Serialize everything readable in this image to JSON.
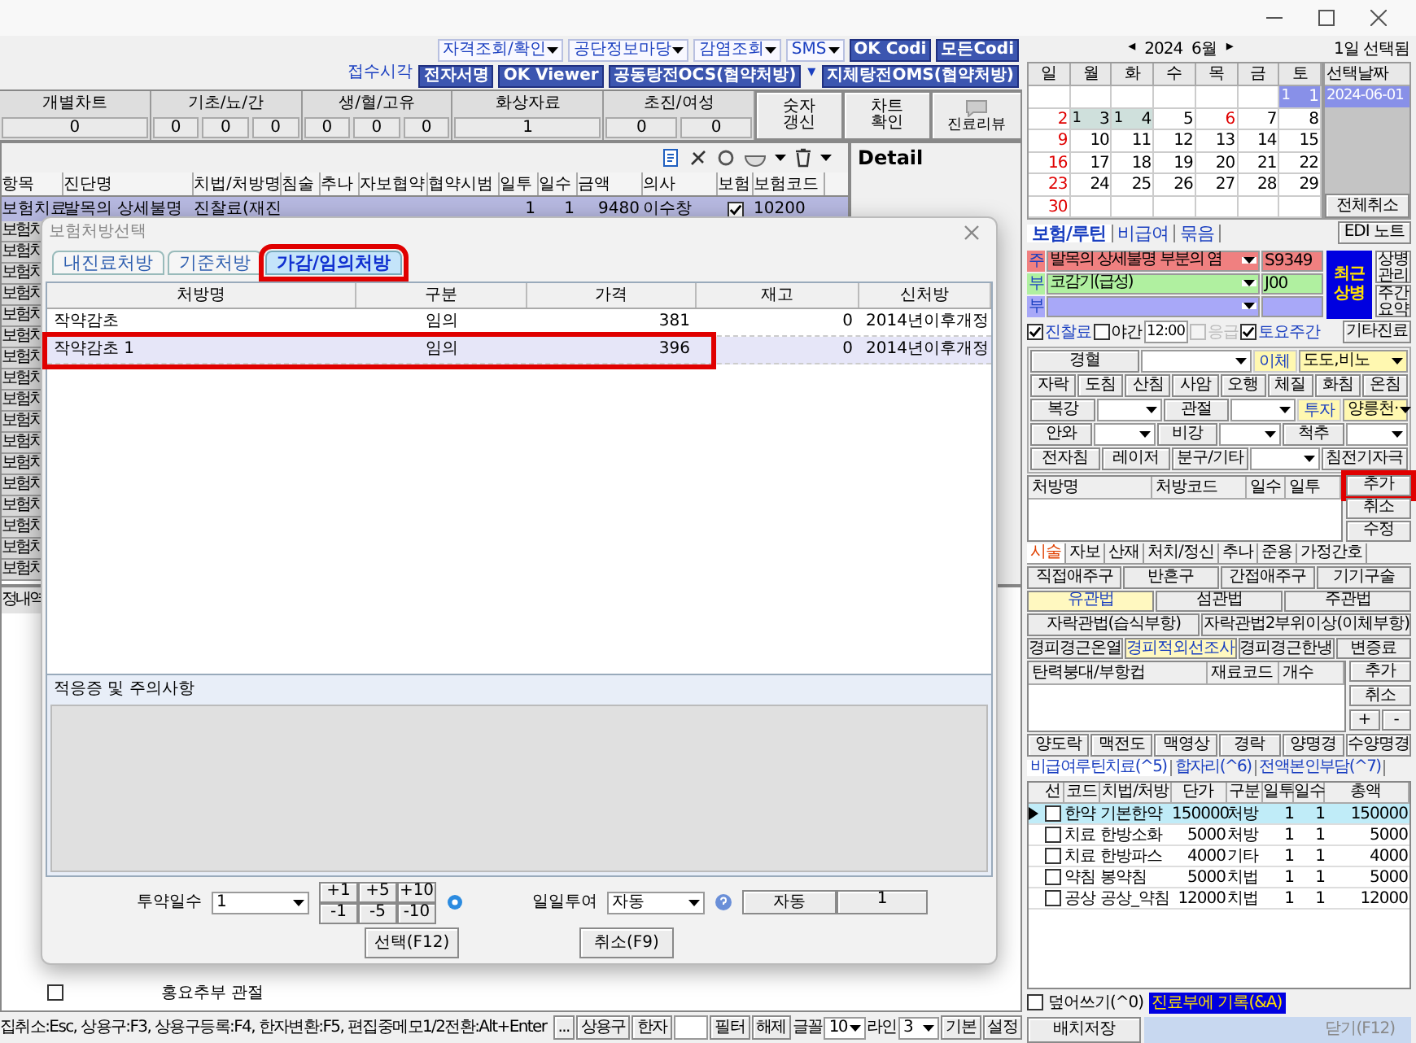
{
  "toolbar": {
    "row1": [
      {
        "label": "자격조회/확인",
        "kind": "dropdown"
      },
      {
        "label": "공단정보마당",
        "kind": "dropdown"
      },
      {
        "label": "감염조회",
        "kind": "dropdown"
      },
      {
        "label": "SMS",
        "kind": "dropdown"
      },
      {
        "label": "OK Codi",
        "kind": "badge"
      },
      {
        "label": "모든Codi",
        "kind": "badge"
      }
    ],
    "row2": [
      {
        "label": "접수시각",
        "kind": "link"
      },
      {
        "label": "전자서명",
        "kind": "badge"
      },
      {
        "label": "OK Viewer",
        "kind": "badge"
      },
      {
        "label": "공동탕전OCS(협약처방)",
        "kind": "badge"
      },
      {
        "label": "▾",
        "kind": "link"
      },
      {
        "label": "지체탕전OMS(협약처방)",
        "kind": "badge"
      }
    ]
  },
  "stats": [
    {
      "label": "개별차트",
      "values": [
        "0"
      ]
    },
    {
      "label": "기초/뇨/간",
      "values": [
        "0",
        "0",
        "0"
      ]
    },
    {
      "label": "생/혈/고유",
      "values": [
        "0",
        "0",
        "0"
      ]
    },
    {
      "label": "화상자료",
      "values": [
        "1"
      ]
    },
    {
      "label": "초진/여성",
      "values": [
        "0",
        "0"
      ]
    }
  ],
  "stat_buttons": [
    "숫자\n갱신",
    "차트\n확인"
  ],
  "review_button": "진료리뷰",
  "main_table": {
    "columns": [
      "항목",
      "진단명",
      "치법/처방명",
      "침술",
      "추나",
      "자보협약",
      "협약시범",
      "일투",
      "일수",
      "금액",
      "의사",
      "보험",
      "보험코드"
    ],
    "rows": [
      {
        "category": "보험치료",
        "diagnosis": "발목의 상세불명",
        "treatment": "진찰료(재진",
        "dose": "1",
        "days": "1",
        "amount": "9480",
        "doctor": "이수창",
        "insured": true,
        "code": "10200"
      }
    ],
    "side_labels": [
      "보험치",
      "보험치",
      "보험치",
      "보험치",
      "보험치",
      "보험치",
      "보험치",
      "보험치",
      "보험치",
      "보험치",
      "보험치",
      "보험치",
      "보험치",
      "보험치",
      "보험치",
      "보험치",
      "보험치"
    ]
  },
  "detail": {
    "title": "Detail"
  },
  "history": {
    "title": "정내역",
    "rows": [
      {
        "label": "홍요추부 관절",
        "checked": false
      }
    ]
  },
  "dialog": {
    "title": "보험처방선택",
    "tabs": [
      {
        "label": "내진료처방",
        "selected": false,
        "annotated": false
      },
      {
        "label": "기준처방",
        "selected": false,
        "annotated": false
      },
      {
        "label": "가감/임의처방",
        "selected": true,
        "annotated": true
      }
    ],
    "columns": [
      "처방명",
      "구분",
      "가격",
      "재고",
      "신처방"
    ],
    "rows": [
      {
        "cells": [
          "작약감초",
          "임의",
          "381",
          "0",
          "2014년이후개정"
        ],
        "selected": false,
        "annotated": false
      },
      {
        "cells": [
          "작약감초 1",
          "임의",
          "396",
          "0",
          "2014년이후개정"
        ],
        "selected": true,
        "annotated": true
      }
    ],
    "notes_label": "적응증 및 주의사항",
    "days_label": "투약일수",
    "days_value": "1",
    "steps": [
      "+1",
      "+5",
      "+10",
      "-1",
      "-5",
      "-10"
    ],
    "daily_label": "일일투여",
    "daily_value": "자동",
    "auto_button": "자동",
    "count": "1",
    "buttons": [
      "선택(F12)",
      "취소(F9)"
    ]
  },
  "status_bar": {
    "hint": "집취소:Esc, 상용구:F3, 상용구등록:F4, 한자변환:F5, 편집중메모1/2전환:Alt+Enter",
    "items": [
      {
        "kind": "button",
        "label": "..."
      },
      {
        "kind": "button",
        "label": "상용구"
      },
      {
        "kind": "button",
        "label": "한자"
      },
      {
        "kind": "input"
      },
      {
        "kind": "button",
        "label": "필터"
      },
      {
        "kind": "button",
        "label": "해제"
      },
      {
        "kind": "label",
        "label": "글꼴"
      },
      {
        "kind": "select",
        "label": "10"
      },
      {
        "kind": "label",
        "label": "라인"
      },
      {
        "kind": "select",
        "label": "3"
      },
      {
        "kind": "button",
        "label": "기본"
      },
      {
        "kind": "alert",
        "label": "설정"
      }
    ]
  },
  "calendar": {
    "prev": "◂",
    "month": "2024  6월",
    "next": "▸",
    "selected_label": "1일 선택됨",
    "weekdays": [
      "일",
      "월",
      "화",
      "수",
      "목",
      "금",
      "토"
    ],
    "weeks": [
      [
        {
          "day": "1",
          "mark": "1",
          "holiday": false,
          "selected": true
        }
      ],
      [
        {
          "day": "2",
          "holiday": true,
          "selected": false
        },
        {
          "day": "3",
          "mark": "1",
          "holiday": false,
          "selected": false
        },
        {
          "day": "4",
          "mark": "1",
          "holiday": false,
          "selected": false
        },
        {
          "day": "5",
          "holiday": false,
          "selected": false
        },
        {
          "day": "6",
          "holiday": true,
          "selected": false
        },
        {
          "day": "7",
          "holiday": false,
          "selected": false
        },
        {
          "day": "8",
          "holiday": false,
          "selected": false
        }
      ],
      [
        {
          "day": "9",
          "holiday": true,
          "selected": false
        },
        {
          "day": "10",
          "holiday": false,
          "selected": false
        },
        {
          "day": "11",
          "holiday": false,
          "selected": false
        },
        {
          "day": "12",
          "holiday": false,
          "selected": false
        },
        {
          "day": "13",
          "holiday": false,
          "selected": false
        },
        {
          "day": "14",
          "holiday": false,
          "selected": false
        },
        {
          "day": "15",
          "holiday": false,
          "selected": false
        }
      ],
      [
        {
          "day": "16",
          "holiday": true,
          "selected": false
        },
        {
          "day": "17",
          "holiday": false,
          "selected": false
        },
        {
          "day": "18",
          "holiday": false,
          "selected": false
        },
        {
          "day": "19",
          "holiday": false,
          "selected": false
        },
        {
          "day": "20",
          "holiday": false,
          "selected": false
        },
        {
          "day": "21",
          "holiday": false,
          "selected": false
        },
        {
          "day": "22",
          "holiday": false,
          "selected": false
        }
      ],
      [
        {
          "day": "23",
          "holiday": true,
          "selected": false
        },
        {
          "day": "24",
          "holiday": false,
          "selected": false
        },
        {
          "day": "25",
          "holiday": false,
          "selected": false
        },
        {
          "day": "26",
          "holiday": false,
          "selected": false
        },
        {
          "day": "27",
          "holiday": false,
          "selected": false
        },
        {
          "day": "28",
          "holiday": false,
          "selected": false
        },
        {
          "day": "29",
          "holiday": false,
          "selected": false
        }
      ],
      [
        {
          "day": "30",
          "holiday": true,
          "selected": false
        }
      ]
    ],
    "dates_header": "선택날짜",
    "dates": [
      "2024-06-01"
    ],
    "clear_button": "전체취소"
  },
  "panel_tabs": [
    {
      "label": "보험/루틴",
      "selected": true
    },
    {
      "label": "비급여",
      "selected": false
    },
    {
      "label": "묶음",
      "selected": false
    }
  ],
  "edi_button": "EDI 노트",
  "diagnoses": [
    {
      "role": "주",
      "name": "발목의 상세불명 부분의 염",
      "code": "S9349",
      "color": "#f08080"
    },
    {
      "role": "부",
      "name": "코감기(급성)",
      "code": "J00",
      "color": "#b0f0a0"
    },
    {
      "role": "부",
      "color": "#a8a8f8"
    }
  ],
  "recent_button": "최근\n상병",
  "diag_buttons": [
    "상병\n관리",
    "주간\n요약"
  ],
  "options": [
    {
      "label": "진찰료",
      "checked": true,
      "disabled": false
    },
    {
      "label": "야간",
      "checked": false,
      "disabled": false,
      "time": "12:00"
    },
    {
      "label": "응급",
      "checked": false,
      "disabled": true
    },
    {
      "label": "토요주간",
      "checked": true,
      "disabled": false
    }
  ],
  "other_button": "기타진료",
  "acupuncture": [
    [
      {
        "kind": "button",
        "label": "경혈"
      },
      {
        "kind": "select"
      },
      {
        "kind": "tag",
        "label": "이체"
      },
      {
        "kind": "select",
        "value": "도도,비노"
      }
    ],
    [
      {
        "kind": "button",
        "label": "자락"
      },
      {
        "kind": "button",
        "label": "도침"
      },
      {
        "kind": "button",
        "label": "산침"
      },
      {
        "kind": "button",
        "label": "사암"
      },
      {
        "kind": "button",
        "label": "오행"
      },
      {
        "kind": "button",
        "label": "체질"
      },
      {
        "kind": "button",
        "label": "화침"
      },
      {
        "kind": "button",
        "label": "온침"
      }
    ],
    [
      {
        "kind": "button",
        "label": "복강"
      },
      {
        "kind": "select"
      },
      {
        "kind": "button",
        "label": "관절"
      },
      {
        "kind": "select"
      },
      {
        "kind": "tag",
        "label": "투자"
      },
      {
        "kind": "select",
        "value": "양릉천·"
      }
    ],
    [
      {
        "kind": "button",
        "label": "안와"
      },
      {
        "kind": "select"
      },
      {
        "kind": "button",
        "label": "비강"
      },
      {
        "kind": "select"
      },
      {
        "kind": "button",
        "label": "척추"
      },
      {
        "kind": "select"
      }
    ],
    [
      {
        "kind": "button",
        "label": "전자침"
      },
      {
        "kind": "button",
        "label": "레이저"
      },
      {
        "kind": "button",
        "label": "분구/기타"
      },
      {
        "kind": "select"
      },
      {
        "kind": "button",
        "label": "침전기자극"
      }
    ]
  ],
  "rx_table": {
    "columns": [
      "처방명",
      "처방코드",
      "일수",
      "일투"
    ],
    "buttons": [
      {
        "label": "추가",
        "annotated": true
      },
      {
        "label": "취소",
        "annotated": false
      },
      {
        "label": "수정",
        "annotated": false
      }
    ]
  },
  "treat_tabs": [
    {
      "label": "시술",
      "selected": true
    },
    {
      "label": "자보",
      "selected": false
    },
    {
      "label": "산재",
      "selected": false
    },
    {
      "label": "처치/정신",
      "selected": false
    },
    {
      "label": "추나",
      "selected": false
    },
    {
      "label": "준용",
      "selected": false
    },
    {
      "label": "가정간호",
      "selected": false
    }
  ],
  "treatments": [
    [
      {
        "label": "직접애주구",
        "selected": false
      },
      {
        "label": "반흔구",
        "selected": false
      },
      {
        "label": "간접애주구",
        "selected": false
      },
      {
        "label": "기기구술",
        "selected": false
      }
    ],
    [
      {
        "label": "유관법",
        "selected": true
      },
      {
        "label": "섬관법",
        "selected": false
      },
      {
        "label": "주관법",
        "selected": false
      }
    ],
    [
      {
        "label": "자락관법(습식부항)",
        "selected": false
      },
      {
        "label": "자락관법2부위이상(이체부항)",
        "selected": false
      }
    ],
    [
      {
        "label": "경피경근온열",
        "selected": false
      },
      {
        "label": "경피적외선조사",
        "selected": true
      },
      {
        "label": "경피경근한냉",
        "selected": false
      },
      {
        "label": "변증료",
        "selected": false
      }
    ]
  ],
  "material_table": {
    "columns": [
      "탄력붕대/부항컵",
      "재료코드",
      "개수"
    ],
    "buttons": [
      "추가",
      "취소",
      "+",
      "-"
    ]
  },
  "exam_buttons": [
    "양도락",
    "맥전도",
    "맥영상",
    "경락",
    "양명경",
    "수양명경"
  ],
  "nonpay_tabs": [
    {
      "label": "비급여루틴치료(^5)",
      "selected": true
    },
    {
      "label": "합자리(^6)",
      "selected": false
    },
    {
      "label": "전액본인부담(^7)",
      "selected": false
    }
  ],
  "nonpay_table": {
    "check_header": "선",
    "columns": [
      "코드",
      "치법/처방",
      "단가",
      "구분",
      "일투",
      "일수",
      "총액"
    ],
    "rows": [
      {
        "cells": [
          "한약",
          "기본한약",
          "150000",
          "처방",
          "1",
          "1",
          "150000"
        ],
        "checked": false,
        "selected": true
      },
      {
        "cells": [
          "치료",
          "한방소화",
          "5000",
          "처방",
          "1",
          "1",
          "5000"
        ],
        "checked": false,
        "selected": false
      },
      {
        "cells": [
          "치료",
          "한방파스",
          "4000",
          "기타",
          "1",
          "1",
          "4000"
        ],
        "checked": false,
        "selected": false
      },
      {
        "cells": [
          "약침",
          "봉약침",
          "5000",
          "치법",
          "1",
          "1",
          "5000"
        ],
        "checked": false,
        "selected": false
      },
      {
        "cells": [
          "공상",
          "공상_약침",
          "12000",
          "치법",
          "1",
          "1",
          "12000"
        ],
        "checked": false,
        "selected": false
      }
    ]
  },
  "overwrite": {
    "label": "덮어쓰기(^0)",
    "checked": false
  },
  "record_button": "진료부에 기록(&A)",
  "save_button": "배치저장",
  "close_button": "닫기(F12)"
}
